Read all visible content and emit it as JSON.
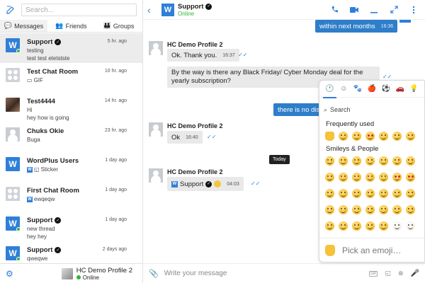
{
  "sidebar": {
    "search_placeholder": "Search...",
    "tabs": [
      {
        "label": "Messages",
        "icon": "chat-icon"
      },
      {
        "label": "Friends",
        "icon": "users-icon"
      },
      {
        "label": "Groups",
        "icon": "group-icon"
      }
    ],
    "conversations": [
      {
        "name": "Support",
        "verified": true,
        "lines": [
          "testing",
          "test test etetstste"
        ],
        "time": "5 hr. ago",
        "avatar": "wp",
        "online": true,
        "active": true
      },
      {
        "name": "Test Chat Room",
        "lines": [
          "GIF"
        ],
        "time": "10 hr. ago",
        "avatar": "grid"
      },
      {
        "name": "Test4444",
        "lines": [
          "Hi",
          "hey how is going"
        ],
        "time": "14 hr. ago",
        "avatar": "photo"
      },
      {
        "name": "Chuks Okie",
        "lines": [
          "Buga"
        ],
        "time": "23 hr. ago",
        "avatar": "blank"
      },
      {
        "name": "WordPlus Users",
        "lines": [
          "Sticker"
        ],
        "time": "1 day ago",
        "avatar": "wp"
      },
      {
        "name": "First Chat Room",
        "lines": [
          "ewqeqw"
        ],
        "time": "1 day ago",
        "avatar": "grid"
      },
      {
        "name": "Support",
        "verified": true,
        "lines": [
          "new thread",
          "hey hey"
        ],
        "time": "1 day ago",
        "avatar": "wp",
        "online": true
      },
      {
        "name": "Support",
        "verified": true,
        "lines": [
          "qweqwe"
        ],
        "time": "2 days ago",
        "avatar": "wp",
        "online": true
      }
    ],
    "me": {
      "name": "HC Demo Profile 2",
      "status": "Online"
    }
  },
  "chat": {
    "title": "Support",
    "status": "Online",
    "messages": {
      "out1": {
        "text": "within next months",
        "time": "16:36"
      },
      "group1": {
        "author": "HC Demo Profile 2",
        "m1": {
          "text": "Ok. Thank you.",
          "time": "16:37"
        },
        "m2": {
          "text": "By the way is there any Black Friday/ Cyber Monday deal for the yearly subscription?"
        }
      },
      "out2": {
        "text": "there is no disc"
      },
      "group2": {
        "author": "HC Demo Profile 2",
        "m1": {
          "text": "Ok",
          "time": "16:40"
        }
      },
      "today": "Today",
      "group3": {
        "author": "HC Demo Profile 2",
        "m1": {
          "text": "Support",
          "time": "04:03"
        }
      }
    },
    "composer_placeholder": "Write your message",
    "gif_label": "GIF"
  },
  "emoji_picker": {
    "search_placeholder": "Search",
    "section1": "Frequently used",
    "section2": "Smileys & People",
    "footer": "Pick an emoji…"
  },
  "colors": {
    "accent": "#2f7fd8",
    "online": "#31b535",
    "bubble_out": "#2e7ec9"
  }
}
